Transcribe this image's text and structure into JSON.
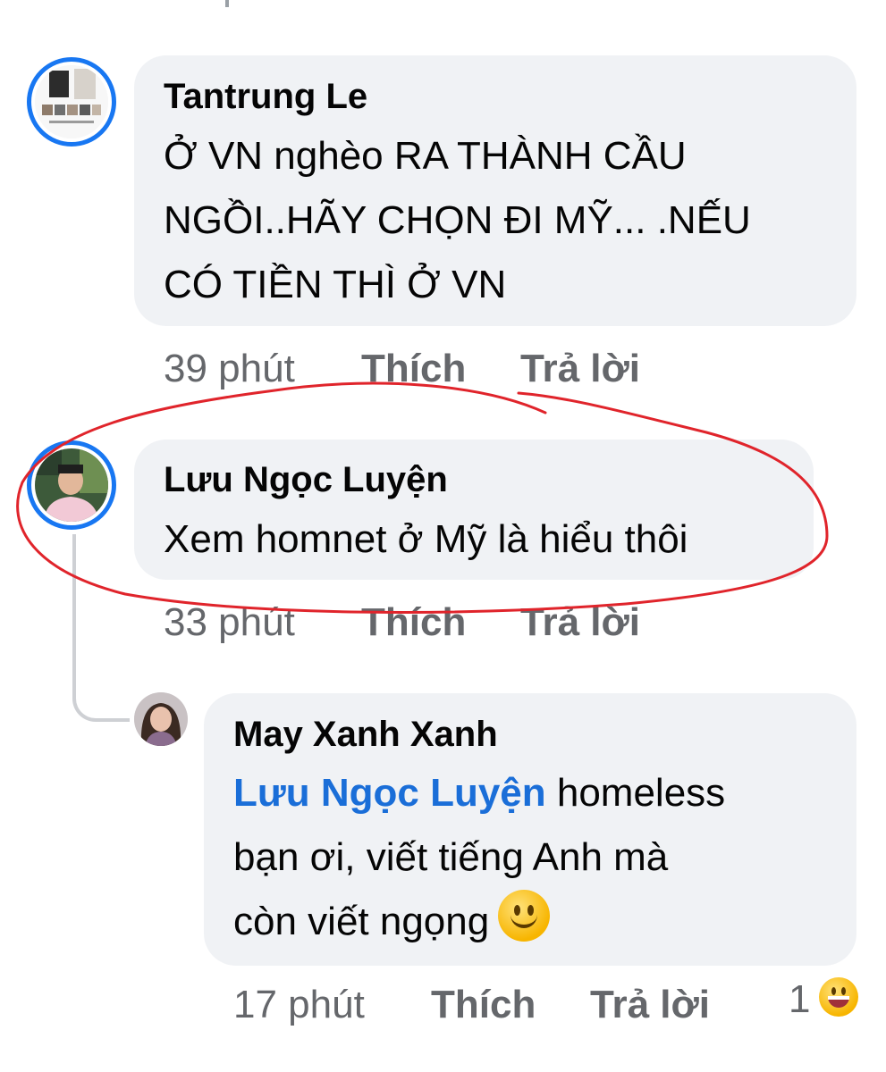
{
  "comments": [
    {
      "author": "Tantrung Le",
      "lines": [
        "Ở VN nghèo RA THÀNH CẦU",
        "NGỒI..HÃY CHỌN ĐI MỸ... .NẾU",
        "CÓ TIỀN THÌ Ở VN"
      ],
      "time": "39 phút",
      "like_label": "Thích",
      "reply_label": "Trả lời"
    },
    {
      "author": "Lưu Ngọc Luyện",
      "lines": [
        "Xem homnet ở Mỹ là hiểu thôi"
      ],
      "time": "33 phút",
      "like_label": "Thích",
      "reply_label": "Trả lời"
    }
  ],
  "reply": {
    "author": "May Xanh Xanh",
    "mention": "Lưu Ngọc Luyện",
    "line1_rest": " homeless",
    "line2": "bạn ơi, viết tiếng Anh mà",
    "line3": "còn viết ngọng",
    "inline_emoji": "smiling-face",
    "time": "17 phút",
    "like_label": "Thích",
    "reply_label": "Trả lời",
    "reaction_count": "1",
    "reaction_emoji": "grinning-face"
  },
  "colors": {
    "bubble": "#f0f2f5",
    "mention": "#1a6ed8",
    "meta": "#65676b",
    "story_ring": "#1877f2",
    "annotation": "#e0242b"
  }
}
